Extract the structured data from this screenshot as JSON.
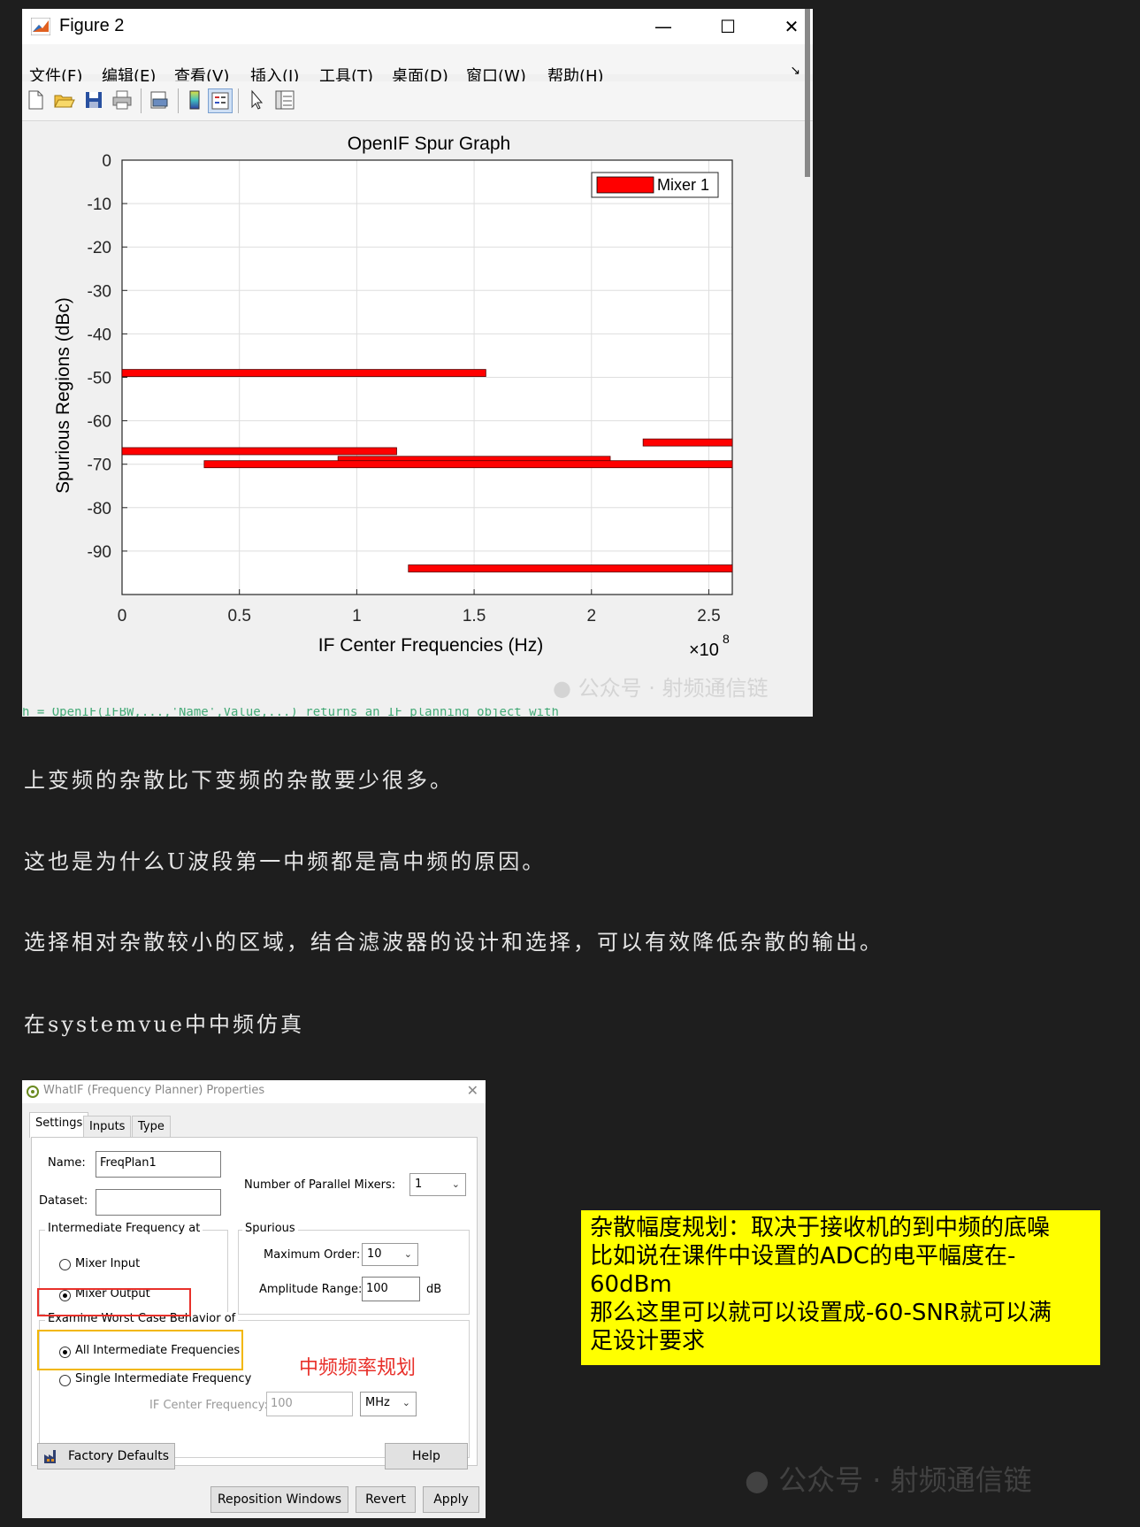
{
  "figure_window": {
    "title": "Figure 2",
    "controls": {
      "minimize": "—",
      "maximize": "☐",
      "close": "✕"
    },
    "menu": [
      "文件(F)",
      "编辑(E)",
      "查看(V)",
      "插入(I)",
      "工具(T)",
      "桌面(D)",
      "窗口(W)",
      "帮助(H)"
    ],
    "menu_arrow": "↘",
    "code_line": "h = OpenIF(IFBW,...,'Name',Value,...) returns an IF planning object with"
  },
  "chart_data": {
    "type": "bar",
    "title": "OpenIF Spur Graph",
    "xlabel": "IF Center Frequencies (Hz)",
    "ylabel": "Spurious Regions (dBc)",
    "x_multiplier": "×10",
    "x_multiplier_exp": "8",
    "xlim": [
      0,
      2.6
    ],
    "ylim": [
      -100,
      0
    ],
    "xticks": [
      0,
      0.5,
      1,
      1.5,
      2,
      2.5
    ],
    "xtick_labels": [
      "0",
      "0.5",
      "1",
      "1.5",
      "2",
      "2.5"
    ],
    "yticks": [
      0,
      -10,
      -20,
      -30,
      -40,
      -50,
      -60,
      -70,
      -80,
      -90
    ],
    "ytick_labels": [
      "0",
      "-10",
      "-20",
      "-30",
      "-40",
      "-50",
      "-60",
      "-70",
      "-80",
      "-90"
    ],
    "grid": true,
    "legend": {
      "placement": "top-right",
      "entries": [
        "Mixer 1"
      ]
    },
    "series": [
      {
        "name": "Mixer 1",
        "color": "#ff0000",
        "spurs": [
          {
            "x_start": 0.0,
            "x_end": 1.55,
            "level": -49
          },
          {
            "x_start": 0.0,
            "x_end": 1.17,
            "level": -67
          },
          {
            "x_start": 0.92,
            "x_end": 2.08,
            "level": -69
          },
          {
            "x_start": 0.35,
            "x_end": 2.6,
            "level": -70
          },
          {
            "x_start": 2.22,
            "x_end": 2.6,
            "level": -65
          },
          {
            "x_start": 1.22,
            "x_end": 2.6,
            "level": -94
          }
        ]
      }
    ]
  },
  "paragraphs": [
    "上变频的杂散比下变频的杂散要少很多。",
    "这也是为什么U波段第一中频都是高中频的原因。",
    "选择相对杂散较小的区域，结合滤波器的设计和选择，可以有效降低杂散的输出。",
    "在systemvue中中频仿真"
  ],
  "dialog": {
    "title": "WhatIF (Frequency Planner) Properties",
    "close": "✕",
    "tabs": [
      "Settings",
      "Inputs",
      "Type"
    ],
    "name_label": "Name:",
    "name_value": "FreqPlan1",
    "dataset_label": "Dataset:",
    "dataset_value": "",
    "parallel_label": "Number of Parallel Mixers:",
    "parallel_value": "1",
    "if_group_title": "Intermediate Frequency at",
    "if_options": [
      "Mixer Input",
      "Mixer Output"
    ],
    "spurious_group_title": "Spurious",
    "max_order_label": "Maximum Order:",
    "max_order_value": "10",
    "amp_range_label": "Amplitude Range:",
    "amp_range_value": "100",
    "amp_range_unit": "dB",
    "worst_group_title": "Examine Worst Case Behavior of",
    "worst_options": [
      "All Intermediate Frequencies",
      "Single Intermediate Frequency"
    ],
    "ifc_label": "IF Center Frequency:",
    "ifc_value": "100",
    "ifc_unit": "MHz",
    "factory_defaults": "Factory Defaults",
    "help": "Help",
    "reposition": "Reposition Windows",
    "revert": "Revert",
    "apply": "Apply",
    "annotation": "中频频率规划"
  },
  "note": {
    "lines": [
      "杂散幅度规划：取决于接收机的到中频的底噪",
      "比如说在课件中设置的ADC的电平幅度在-",
      "60dBm",
      "那么这里可以就可以设置成-60-SNR就可以满",
      "足设计要求"
    ]
  },
  "watermark": {
    "text": "公众号 · 射频通信链",
    "text2": "公众号 · 射频通信链"
  }
}
